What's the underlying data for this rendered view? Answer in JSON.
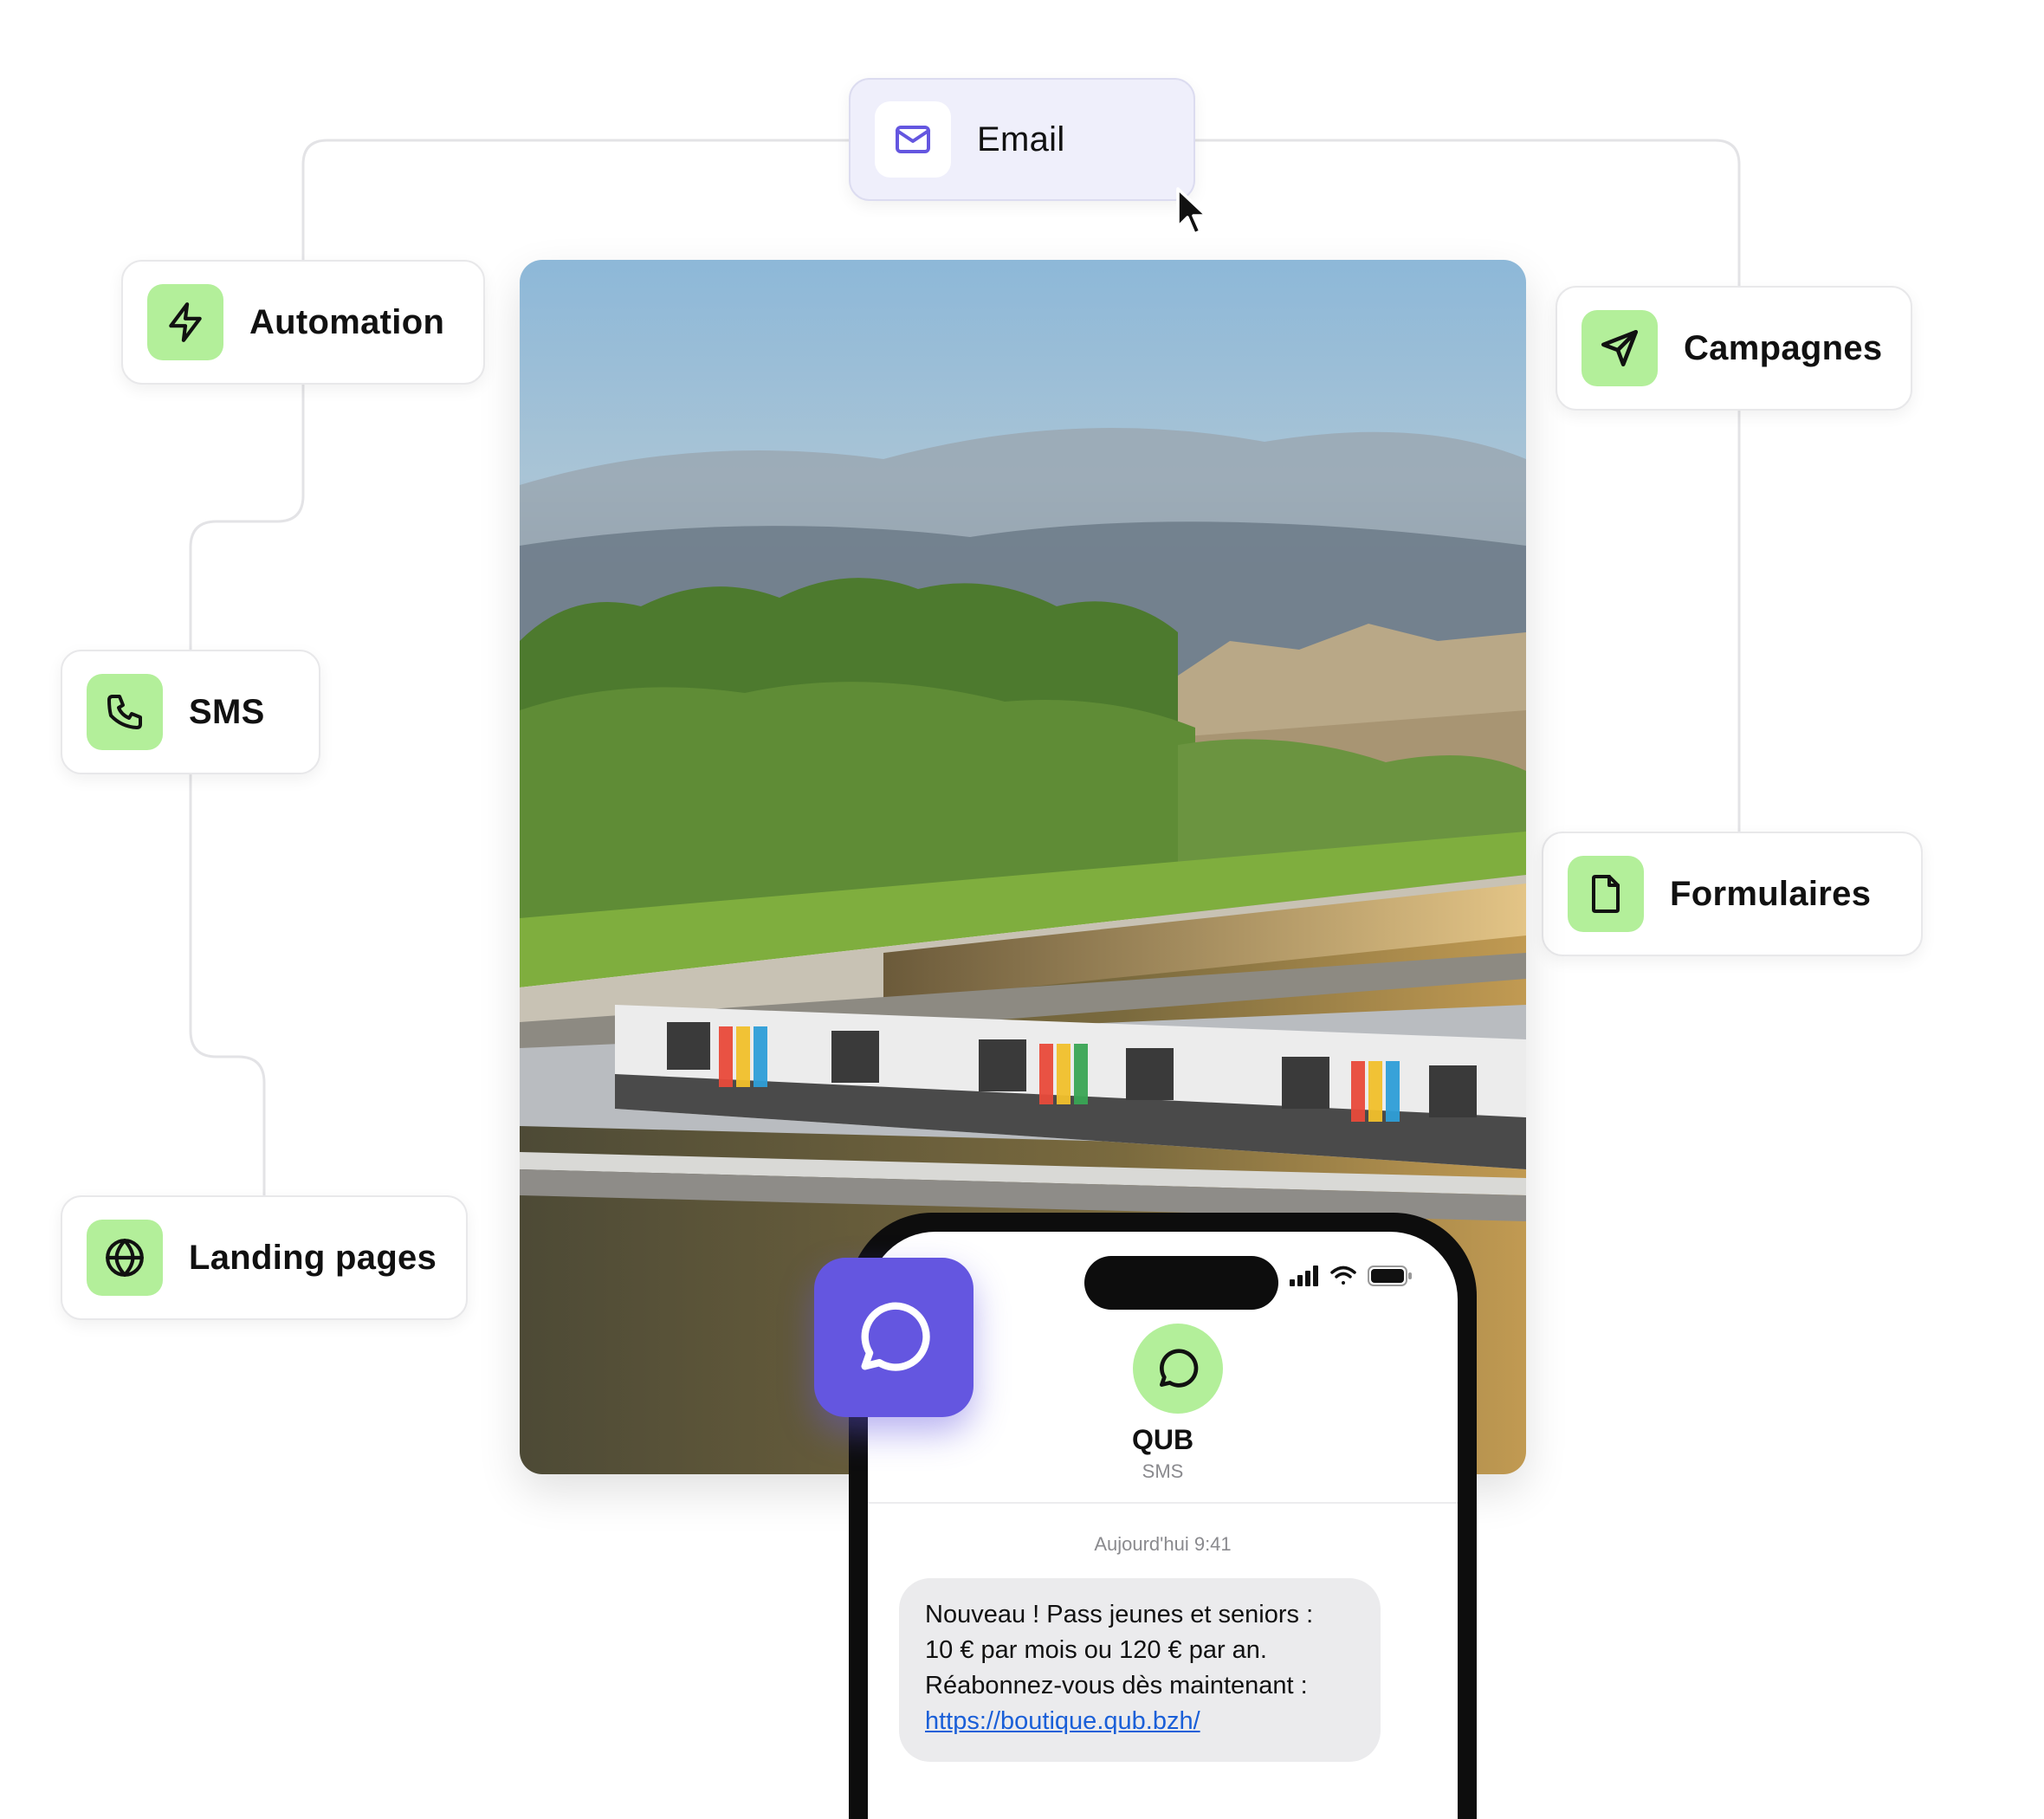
{
  "channels": {
    "email": {
      "label": "Email",
      "icon": "mail-icon"
    },
    "automation": {
      "label": "Automation",
      "icon": "lightning-icon"
    },
    "campagnes": {
      "label": "Campagnes",
      "icon": "send-icon"
    },
    "sms": {
      "label": "SMS",
      "icon": "phone-icon"
    },
    "formulaires": {
      "label": "Formulaires",
      "icon": "document-icon"
    },
    "landing": {
      "label": "Landing pages",
      "icon": "globe-icon"
    }
  },
  "photo": {
    "subject": "tram-river-city-photo"
  },
  "phone": {
    "contact_name": "QUB",
    "contact_type": "SMS",
    "timestamp": "Aujourd'hui 9:41",
    "message": {
      "line1": "Nouveau ! Pass jeunes et seniors :",
      "line2": "10 € par mois ou 120 € par an.",
      "line3": "Réabonnez-vous dès maintenant :",
      "link": "https://boutique.qub.bzh/"
    }
  },
  "colors": {
    "accent_purple": "#6456e0",
    "icon_green": "#b3ef9a",
    "email_card_bg": "#efeffb",
    "link_blue": "#1a5fd8"
  }
}
